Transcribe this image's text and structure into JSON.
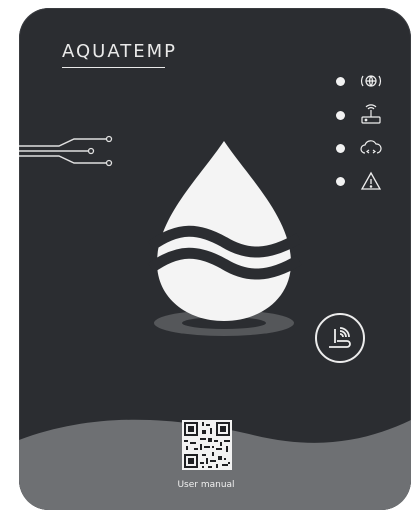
{
  "brand": {
    "name": "AQUATEMP"
  },
  "status_indicators": [
    {
      "icon": "globe-icon"
    },
    {
      "icon": "router-icon"
    },
    {
      "icon": "cloud-icon"
    },
    {
      "icon": "warning-icon"
    }
  ],
  "button": {
    "icon": "wifi-pairing-icon"
  },
  "qr": {
    "label": "User manual"
  },
  "colors": {
    "panel": "#2b2d31",
    "bottom_wave": "#6e7073",
    "indicator": "#f2f2f2"
  }
}
